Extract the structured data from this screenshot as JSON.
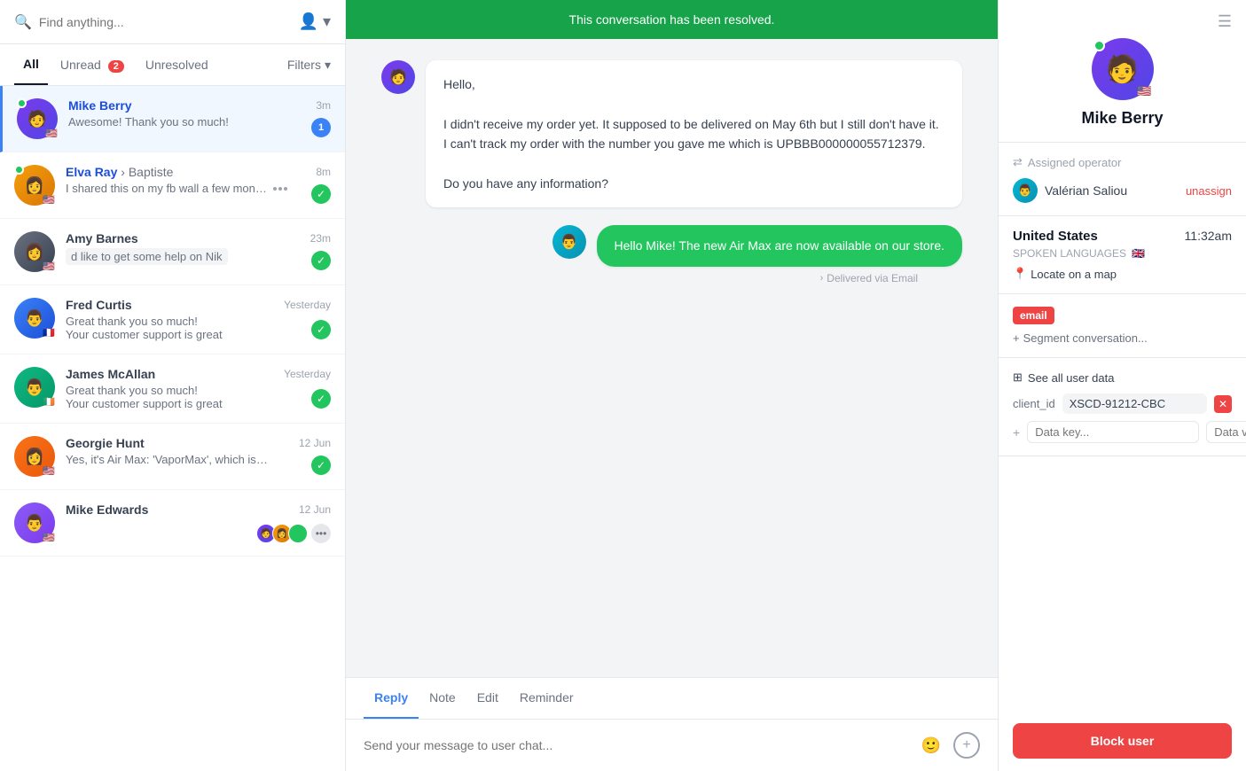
{
  "sidebar": {
    "search_placeholder": "Find anything...",
    "tabs": [
      {
        "label": "All",
        "active": true,
        "badge": null
      },
      {
        "label": "Unread",
        "active": false,
        "badge": "2"
      },
      {
        "label": "Unresolved",
        "active": false,
        "badge": null
      },
      {
        "label": "Filters",
        "active": false,
        "badge": null,
        "icon": "chevron-down"
      }
    ],
    "conversations": [
      {
        "id": 1,
        "name": "Mike Berry",
        "subname": null,
        "avatar_class": "av-mike",
        "flag": "🇺🇸",
        "online": true,
        "time": "3m",
        "preview": "Awesome! Thank you so much!",
        "status": "unread_badge",
        "badge_count": "1",
        "active": true
      },
      {
        "id": 2,
        "name": "Elva Ray",
        "subname": "Baptiste",
        "avatar_class": "av-elva",
        "flag": "🇺🇸",
        "online": true,
        "time": "8m",
        "preview": "I shared this on my fb wall a few months backshare, and I got a...",
        "status": "check",
        "active": false
      },
      {
        "id": 3,
        "name": "Amy Barnes",
        "subname": null,
        "avatar_class": "av-amy",
        "flag": "🇺🇸",
        "online": false,
        "time": "23m",
        "preview": "d like to get some help on Nik",
        "status": "check",
        "active": false
      },
      {
        "id": 4,
        "name": "Fred Curtis",
        "subname": null,
        "avatar_class": "av-fred",
        "flag": "🇫🇷",
        "online": false,
        "time": "Yesterday",
        "preview": "Great thank you so much!\nYour customer support is great",
        "status": "check",
        "active": false
      },
      {
        "id": 5,
        "name": "James McAllan",
        "subname": null,
        "avatar_class": "av-james",
        "flag": "🇮🇪",
        "online": false,
        "time": "Yesterday",
        "preview": "Great thank you so much!\nYour customer support is great",
        "status": "check",
        "active": false
      },
      {
        "id": 6,
        "name": "Georgie Hunt",
        "subname": null,
        "avatar_class": "av-georgie",
        "flag": "🇺🇸",
        "online": false,
        "time": "12 Jun",
        "preview": "Yes, it's Air Max: 'VaporMax', which is no longer offered. So...",
        "status": "check",
        "active": false
      },
      {
        "id": 7,
        "name": "Mike Edwards",
        "subname": null,
        "avatar_class": "av-mikee",
        "flag": "🇺🇸",
        "online": false,
        "time": "12 Jun",
        "preview": "",
        "status": "mini_avatars",
        "active": false
      }
    ]
  },
  "banner": {
    "text": "This conversation has been resolved."
  },
  "messages": [
    {
      "id": 1,
      "side": "left",
      "avatar_class": "av-mike",
      "text": "Hello,\n\nI didn't receive my order yet. It supposed to be delivered on May 6th but I still don't have it. I can't track my order with the number you gave me which is UPBBB000000055712379.\n\nDo you have any information?"
    },
    {
      "id": 2,
      "side": "right",
      "avatar_class": "av-valerian",
      "text": "Hello Mike! The new Air Max are now available on our store.",
      "delivered_label": "Delivered via Email"
    }
  ],
  "reply": {
    "tabs": [
      "Reply",
      "Note",
      "Edit",
      "Reminder"
    ],
    "active_tab": "Reply",
    "input_placeholder": "Send your message to user chat..."
  },
  "right_panel": {
    "user_name": "Mike Berry",
    "user_flag": "🇺🇸",
    "assigned_operator_label": "Assigned operator",
    "operator": {
      "name": "Valérian Saliou",
      "avatar_class": "av-valerian",
      "unassign_label": "unassign"
    },
    "location": {
      "country": "United States",
      "time": "11:32am",
      "spoken_languages_label": "SPOKEN LANGUAGES",
      "flag": "🇬🇧",
      "locate_label": "Locate on a map"
    },
    "tags": [
      "email"
    ],
    "segment_placeholder": "Segment conversation...",
    "see_all_label": "See all user data",
    "user_data": [
      {
        "key": "client_id",
        "value": "XSCD-91212-CBC"
      }
    ],
    "data_key_placeholder": "Data key...",
    "data_value_placeholder": "Data value...",
    "block_label": "Block user"
  }
}
